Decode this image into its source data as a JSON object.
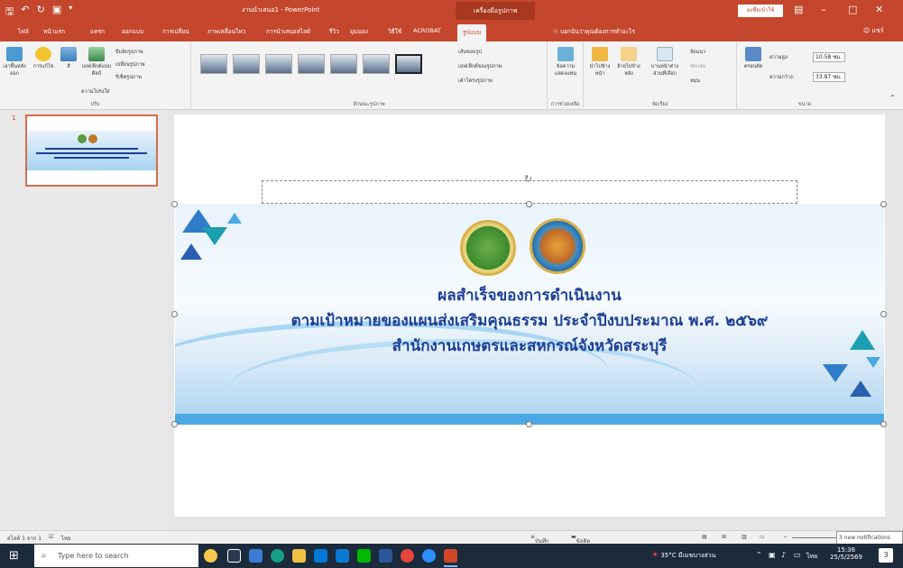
{
  "titlebar": {
    "doc_title": "งานนำเสนอ1 - PowerPoint",
    "context_tab": "เครื่องมือรูปภาพ",
    "signin": "ลงชื่อเข้าใช้"
  },
  "tabs": [
    "ไฟล์",
    "หน้าแรก",
    "แทรก",
    "ออกแบบ",
    "การเปลี่ยน",
    "ภาพเคลื่อนไหว",
    "การนำเสนอสไลด์",
    "รีวิว",
    "มุมมอง",
    "วิธีใช้",
    "ACROBAT",
    "รูปแบบ"
  ],
  "active_tab": "รูปแบบ",
  "tell_me": "บอกฉันว่าคุณต้องการทำอะไร",
  "share": "แชร์",
  "ribbon": {
    "adjust": {
      "label": "ปรับ",
      "remove_bg": "เอาพื้นหลังออก",
      "corrections": "การแก้ไข",
      "color": "สี",
      "artistic": "เอฟเฟ็กต์แบบศิลป์",
      "transparency": "ความโปร่งใส",
      "compress": "บีบอัดรูปภาพ",
      "change": "เปลี่ยนรูปภาพ",
      "reset": "รีเซ็ตรูปภาพ"
    },
    "styles": {
      "label": "ลักษณะรูปภาพ",
      "border": "เส้นขอบรูป",
      "effects": "เอฟเฟ็กต์ของรูปภาพ",
      "layout": "เค้าโครงรูปภาพ"
    },
    "accessibility": {
      "label": "การช่วยเหลือ",
      "alt_text": "ข้อความแสดงแทน"
    },
    "arrange": {
      "label": "จัดเรียง",
      "forward": "นำไปข้างหน้า",
      "backward": "ย้ายไปข้างหลัง",
      "pane": "บานหน้าต่างส่วนที่เลือก",
      "align": "จัดแนว",
      "group": "จัดกลุ่ม",
      "rotate": "หมุน"
    },
    "size": {
      "label": "ขนาด",
      "crop": "ครอบตัด",
      "height_label": "ความสูง:",
      "height_value": "10.58 ซม.",
      "width_label": "ความกว้าง:",
      "width_value": "33.87 ซม."
    }
  },
  "thumbnail": {
    "number": "1"
  },
  "slide": {
    "line1": "ผลสำเร็จของการดำเนินงาน",
    "line2": "ตามเป้าหมายของแผนส่งเสริมคุณธรรม ประจำปีงบประมาณ พ.ศ. ๒๕๖๙",
    "line3": "สำนักงานเกษตรและสหกรณ์จังหวัดสระบุรี"
  },
  "status": {
    "slide_info": "สไลด์ 1 จาก 1",
    "language": "ไทย",
    "notes": "บันทึกย่อ",
    "comments": "ข้อคิดเห็น",
    "notifications": "3 new notifications"
  },
  "taskbar": {
    "search_placeholder": "Type here to search",
    "weather": "35°C มีเมฆบางส่วน",
    "lang": "ไทย",
    "time": "15:36",
    "date": "25/5/2569"
  },
  "colors": {
    "accent": "#c4472d",
    "title_text": "#1d3f96",
    "taskbar": "#1c2b3c"
  }
}
